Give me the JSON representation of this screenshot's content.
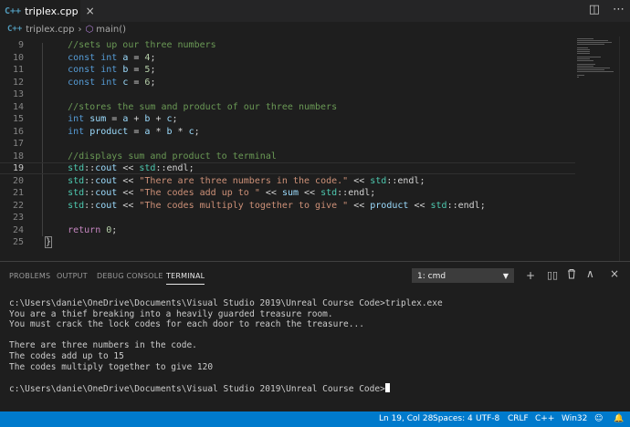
{
  "tab": {
    "icon_text": "C++",
    "title": "triplex.cpp",
    "close": "×"
  },
  "breadcrumbs": {
    "file": "triplex.cpp",
    "separator": "›",
    "symbol": "main()"
  },
  "editor": {
    "current_line": 19,
    "lines": [
      {
        "num": 9,
        "tokens": [
          {
            "t": "    "
          },
          {
            "t": "//sets up our three numbers",
            "c": "comment"
          }
        ]
      },
      {
        "num": 10,
        "tokens": [
          {
            "t": "    "
          },
          {
            "t": "const",
            "c": "kw"
          },
          {
            "t": " "
          },
          {
            "t": "int",
            "c": "kw"
          },
          {
            "t": " "
          },
          {
            "t": "a",
            "c": "var"
          },
          {
            "t": " = "
          },
          {
            "t": "4",
            "c": "num"
          },
          {
            "t": ";"
          }
        ]
      },
      {
        "num": 11,
        "tokens": [
          {
            "t": "    "
          },
          {
            "t": "const",
            "c": "kw"
          },
          {
            "t": " "
          },
          {
            "t": "int",
            "c": "kw"
          },
          {
            "t": " "
          },
          {
            "t": "b",
            "c": "var"
          },
          {
            "t": " = "
          },
          {
            "t": "5",
            "c": "num"
          },
          {
            "t": ";"
          }
        ]
      },
      {
        "num": 12,
        "tokens": [
          {
            "t": "    "
          },
          {
            "t": "const",
            "c": "kw"
          },
          {
            "t": " "
          },
          {
            "t": "int",
            "c": "kw"
          },
          {
            "t": " "
          },
          {
            "t": "c",
            "c": "var"
          },
          {
            "t": " = "
          },
          {
            "t": "6",
            "c": "num"
          },
          {
            "t": ";"
          }
        ]
      },
      {
        "num": 13,
        "tokens": []
      },
      {
        "num": 14,
        "tokens": [
          {
            "t": "    "
          },
          {
            "t": "//stores the sum and product of our three numbers",
            "c": "comment"
          }
        ]
      },
      {
        "num": 15,
        "tokens": [
          {
            "t": "    "
          },
          {
            "t": "int",
            "c": "kw"
          },
          {
            "t": " "
          },
          {
            "t": "sum",
            "c": "var"
          },
          {
            "t": " = "
          },
          {
            "t": "a",
            "c": "var"
          },
          {
            "t": " + "
          },
          {
            "t": "b",
            "c": "var"
          },
          {
            "t": " + "
          },
          {
            "t": "c",
            "c": "var"
          },
          {
            "t": ";"
          }
        ]
      },
      {
        "num": 16,
        "tokens": [
          {
            "t": "    "
          },
          {
            "t": "int",
            "c": "kw"
          },
          {
            "t": " "
          },
          {
            "t": "product",
            "c": "var"
          },
          {
            "t": " = "
          },
          {
            "t": "a",
            "c": "var"
          },
          {
            "t": " * "
          },
          {
            "t": "b",
            "c": "var"
          },
          {
            "t": " * "
          },
          {
            "t": "c",
            "c": "var"
          },
          {
            "t": ";"
          }
        ]
      },
      {
        "num": 17,
        "tokens": []
      },
      {
        "num": 18,
        "tokens": [
          {
            "t": "    "
          },
          {
            "t": "//displays sum and product to terminal",
            "c": "comment"
          }
        ]
      },
      {
        "num": 19,
        "tokens": [
          {
            "t": "    "
          },
          {
            "t": "std",
            "c": "ns"
          },
          {
            "t": "::"
          },
          {
            "t": "cout",
            "c": "var"
          },
          {
            "t": " << "
          },
          {
            "t": "std",
            "c": "ns"
          },
          {
            "t": "::endl;"
          }
        ]
      },
      {
        "num": 20,
        "tokens": [
          {
            "t": "    "
          },
          {
            "t": "std",
            "c": "ns"
          },
          {
            "t": "::"
          },
          {
            "t": "cout",
            "c": "var"
          },
          {
            "t": " << "
          },
          {
            "t": "\"There are three numbers in the code.\"",
            "c": "str"
          },
          {
            "t": " << "
          },
          {
            "t": "std",
            "c": "ns"
          },
          {
            "t": "::endl;"
          }
        ]
      },
      {
        "num": 21,
        "tokens": [
          {
            "t": "    "
          },
          {
            "t": "std",
            "c": "ns"
          },
          {
            "t": "::"
          },
          {
            "t": "cout",
            "c": "var"
          },
          {
            "t": " << "
          },
          {
            "t": "\"The codes add up to \"",
            "c": "str"
          },
          {
            "t": " << "
          },
          {
            "t": "sum",
            "c": "var"
          },
          {
            "t": " << "
          },
          {
            "t": "std",
            "c": "ns"
          },
          {
            "t": "::endl;"
          }
        ]
      },
      {
        "num": 22,
        "tokens": [
          {
            "t": "    "
          },
          {
            "t": "std",
            "c": "ns"
          },
          {
            "t": "::"
          },
          {
            "t": "cout",
            "c": "var"
          },
          {
            "t": " << "
          },
          {
            "t": "\"The codes multiply together to give \"",
            "c": "str"
          },
          {
            "t": " << "
          },
          {
            "t": "product",
            "c": "var"
          },
          {
            "t": " << "
          },
          {
            "t": "std",
            "c": "ns"
          },
          {
            "t": "::endl;"
          }
        ]
      },
      {
        "num": 23,
        "tokens": []
      },
      {
        "num": 24,
        "tokens": [
          {
            "t": "    "
          },
          {
            "t": "return",
            "c": "ctrl"
          },
          {
            "t": " "
          },
          {
            "t": "0",
            "c": "num"
          },
          {
            "t": ";"
          }
        ]
      },
      {
        "num": 25,
        "tokens": [
          {
            "t": "}",
            "c": "brace"
          }
        ]
      }
    ]
  },
  "panel": {
    "tabs": [
      "PROBLEMS",
      "OUTPUT",
      "DEBUG CONSOLE",
      "TERMINAL"
    ],
    "active_tab": "TERMINAL",
    "terminal_select": "1: cmd",
    "actions": {
      "add": "+",
      "split": "⊞",
      "trash": "🗑",
      "maximize": "∧",
      "close": "×"
    }
  },
  "terminal": {
    "lines": [
      "c:\\Users\\danie\\OneDrive\\Documents\\Visual Studio 2019\\Unreal Course Code>triplex.exe",
      "You are a thief breaking into a heavily guarded treasure room.",
      "You must crack the lock codes for each door to reach the treasure...",
      "",
      "There are three numbers in the code.",
      "The codes add up to 15",
      "The codes multiply together to give 120",
      "",
      "c:\\Users\\danie\\OneDrive\\Documents\\Visual Studio 2019\\Unreal Course Code>"
    ]
  },
  "statusbar": {
    "position": "Ln 19, Col 28",
    "spaces": "Spaces: 4",
    "encoding": "UTF-8",
    "eol": "CRLF",
    "language": "C++",
    "platform": "Win32"
  },
  "colors": {
    "statusbar": "#007acc",
    "editor_bg": "#1e1e1e",
    "tab_bg": "#252526"
  }
}
